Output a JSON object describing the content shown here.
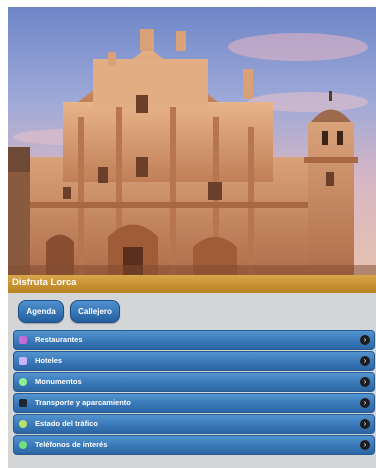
{
  "header": {
    "title": "Disfruta Lorca"
  },
  "buttons": {
    "agenda": "Agenda",
    "callejero": "Callejero"
  },
  "menu": {
    "items": [
      {
        "label": "Restaurantes",
        "icon": "cutlery-icon",
        "icon_color": "#c46bd6"
      },
      {
        "label": "Hoteles",
        "icon": "bed-icon",
        "icon_color": "#c8b3ff"
      },
      {
        "label": "Monumentos",
        "icon": "monument-icon",
        "icon_color": "#8ef08e"
      },
      {
        "label": "Transporte y aparcamiento",
        "icon": "bus-icon",
        "icon_color": "#1f2430"
      },
      {
        "label": "Estado del tráfico",
        "icon": "traffic-light-icon",
        "icon_color": "#b7e36a"
      },
      {
        "label": "Teléfonos de interés",
        "icon": "phone-icon",
        "icon_color": "#6fe07a"
      }
    ]
  },
  "colors": {
    "title_bar": "#c8922f",
    "menu_row": "#3f7dbf",
    "button": "#2f6fb0"
  }
}
